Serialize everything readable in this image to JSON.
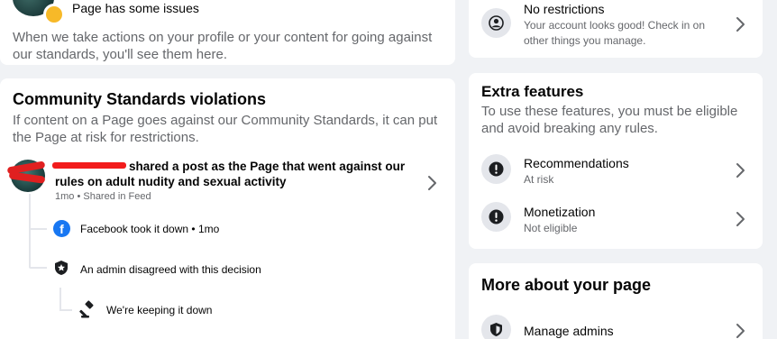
{
  "issues_card": {
    "title": "Page has some issues",
    "description": "When we take actions on your profile or your content for going against our standards, you'll see them here."
  },
  "community_standards": {
    "title": "Community Standards violations",
    "description": "If content on a Page goes against our Community Standards, it can put the Page at risk for restrictions.",
    "post": {
      "text": "shared a post as the Page that went against our rules on adult nudity and sexual activity",
      "meta": "1mo • Shared in Feed"
    },
    "timeline": [
      {
        "label": "Facebook took it down • 1mo",
        "icon": "facebook-icon"
      },
      {
        "label": "An admin disagreed with this decision",
        "icon": "shield-icon"
      },
      {
        "label": "We're keeping it down",
        "icon": "gavel-icon"
      }
    ]
  },
  "restrictions": {
    "title": "No restrictions",
    "description": "Your account looks good! Check in on other things you manage."
  },
  "extra_features": {
    "title": "Extra features",
    "description": "To use these features, you must be eligible and avoid breaking any rules.",
    "items": [
      {
        "title": "Recommendations",
        "status": "At risk",
        "icon": "alert-icon"
      },
      {
        "title": "Monetization",
        "status": "Not eligible",
        "icon": "alert-icon"
      }
    ]
  },
  "more_about": {
    "title": "More about your page",
    "items": [
      {
        "title": "Manage admins",
        "icon": "shield-icon"
      }
    ]
  },
  "colors": {
    "background": "#f0f2f5",
    "facebook_blue": "#1877f2",
    "warning": "#f7b928",
    "secondary_text": "#65676b"
  }
}
